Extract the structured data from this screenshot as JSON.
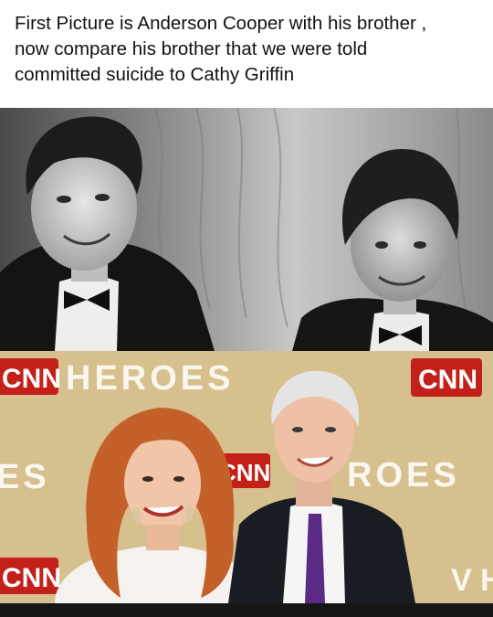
{
  "caption": {
    "lines": [
      "First Picture is Anderson Cooper with his brother ,",
      "now compare his brother that we were told",
      "committed suicide to Cathy Griffin"
    ]
  },
  "top_photo": {
    "style": "black-and-white photograph",
    "subjects": 2
  },
  "bottom_photo": {
    "backdrop": {
      "logo_text": "CNN",
      "heroes_left": "HEROES",
      "mid_left": "ES",
      "mid_right": "ROES",
      "bottom_right": "V H"
    },
    "colors": {
      "backdrop": "#d6c08d",
      "logo_red": "#c4201a",
      "heroes_white": "#fbf7ee"
    }
  },
  "icons": [
    "cnn-logo"
  ]
}
